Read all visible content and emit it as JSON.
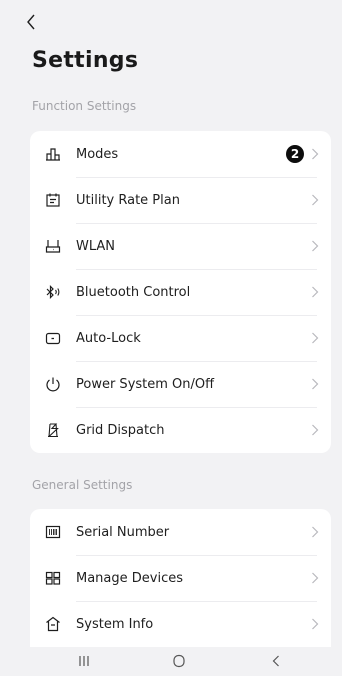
{
  "header": {
    "title": "Settings",
    "back_icon": "chevron-left-icon"
  },
  "sections": [
    {
      "label": "Function Settings",
      "items": [
        {
          "label": "Modes",
          "icon": "modes-icon",
          "badge": "2"
        },
        {
          "label": "Utility Rate Plan",
          "icon": "utility-rate-icon"
        },
        {
          "label": "WLAN",
          "icon": "router-icon"
        },
        {
          "label": "Bluetooth Control",
          "icon": "bluetooth-icon"
        },
        {
          "label": "Auto-Lock",
          "icon": "lock-screen-icon"
        },
        {
          "label": "Power System On/Off",
          "icon": "power-icon"
        },
        {
          "label": "Grid Dispatch",
          "icon": "grid-tower-icon"
        }
      ]
    },
    {
      "label": "General Settings",
      "items": [
        {
          "label": "Serial Number",
          "icon": "serial-number-icon"
        },
        {
          "label": "Manage Devices",
          "icon": "devices-grid-icon"
        },
        {
          "label": "System Info",
          "icon": "home-info-icon"
        }
      ]
    }
  ],
  "navbar": {
    "icons": [
      "recent-apps-icon",
      "home-icon",
      "back-icon"
    ]
  },
  "colors": {
    "background": "#f2f2f4",
    "card": "#ffffff",
    "text": "#1e1e1e",
    "section_label": "#a3a3a8",
    "badge": "#0d0d0d",
    "chevron": "#b8b8bd"
  }
}
